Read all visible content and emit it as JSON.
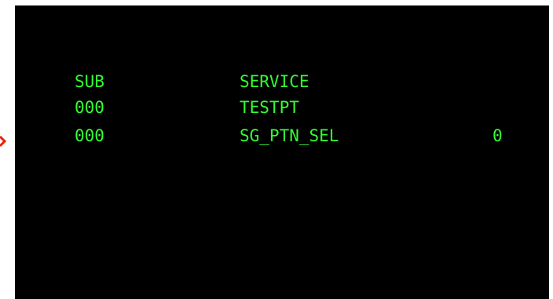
{
  "colors": {
    "screen_background": "#000000",
    "text": "#33ff33",
    "selection_marker": "#e8200a"
  },
  "terminal": {
    "header": {
      "sub": "SUB",
      "service": "SERVICE"
    },
    "rows": [
      {
        "sub": "000",
        "service": "TESTPT",
        "value": ""
      },
      {
        "sub": "000",
        "service": "SG_PTN_SEL",
        "value": "0"
      }
    ]
  },
  "marker": {
    "icon": "selection-arrow-icon",
    "row_index": 1
  }
}
